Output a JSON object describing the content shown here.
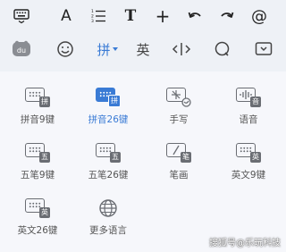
{
  "colors": {
    "accent": "#3a7bd5",
    "icon": "#6a6d73",
    "panel_bg": "#f6f7fb",
    "bar_bg": "#eef1f6"
  },
  "toolbar": {
    "items": [
      {
        "name": "keyboard-hide-icon"
      },
      {
        "name": "font-a-icon",
        "text": "A"
      },
      {
        "name": "numbered-list-icon"
      },
      {
        "name": "text-format-icon",
        "text": "T"
      },
      {
        "name": "plus-icon",
        "text": "+"
      },
      {
        "name": "undo-icon"
      },
      {
        "name": "redo-icon"
      },
      {
        "name": "at-sign-icon",
        "text": "@"
      }
    ]
  },
  "tabs": {
    "logo": "du",
    "pinyin": "拼",
    "english": "英",
    "cursor_icon": "cursor-move-icon",
    "search_icon": "search-icon",
    "hide_icon": "keyboard-collapse-icon"
  },
  "layouts": [
    {
      "label": "拼音9键",
      "badge": "拼",
      "active": false
    },
    {
      "label": "拼音26键",
      "badge": "拼",
      "active": true
    },
    {
      "label": "手写",
      "badge": "",
      "active": false
    },
    {
      "label": "语音",
      "badge": "音",
      "active": false
    },
    {
      "label": "五笔9键",
      "badge": "五",
      "active": false
    },
    {
      "label": "五笔26键",
      "badge": "五",
      "active": false
    },
    {
      "label": "笔画",
      "badge": "笔",
      "active": false
    },
    {
      "label": "英文9键",
      "badge": "英",
      "active": false
    },
    {
      "label": "英文26键",
      "badge": "英",
      "active": false
    },
    {
      "label": "更多语言",
      "badge": "",
      "active": false
    }
  ],
  "watermark": "搜狐号@乐玩科技"
}
